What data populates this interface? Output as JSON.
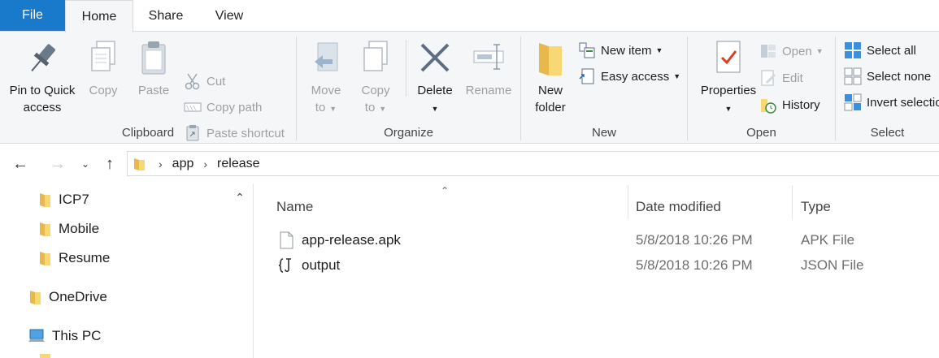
{
  "tabs": {
    "file": "File",
    "home": "Home",
    "share": "Share",
    "view": "View"
  },
  "ribbon": {
    "clipboard": {
      "label": "Clipboard",
      "pin_line1": "Pin to Quick",
      "pin_line2": "access",
      "copy": "Copy",
      "paste": "Paste",
      "cut": "Cut",
      "copy_path": "Copy path",
      "paste_shortcut": "Paste shortcut"
    },
    "organize": {
      "label": "Organize",
      "move_line1": "Move",
      "move_line2": "to",
      "copy_line1": "Copy",
      "copy_line2": "to",
      "delete": "Delete",
      "rename": "Rename"
    },
    "new": {
      "label": "New",
      "folder_line1": "New",
      "folder_line2": "folder",
      "new_item": "New item",
      "easy_access": "Easy access"
    },
    "open": {
      "label": "Open",
      "properties": "Properties",
      "open": "Open",
      "edit": "Edit",
      "history": "History"
    },
    "select": {
      "label": "Select",
      "select_all": "Select all",
      "select_none": "Select none",
      "invert": "Invert selection"
    }
  },
  "address": {
    "crumbs": [
      "app",
      "release"
    ]
  },
  "nav_pane": {
    "items": [
      "ICP7",
      "Mobile",
      "Resume",
      "OneDrive",
      "This PC"
    ]
  },
  "file_list": {
    "columns": {
      "name": "Name",
      "date": "Date modified",
      "type": "Type"
    },
    "rows": [
      {
        "name": "app-release.apk",
        "date": "5/8/2018 10:26 PM",
        "type": "APK File"
      },
      {
        "name": "output",
        "date": "5/8/2018 10:26 PM",
        "type": "JSON File"
      }
    ]
  },
  "colors": {
    "accent": "#1979ca",
    "ribbon_bg": "#f5f6f7",
    "folder": "#f8d775"
  }
}
